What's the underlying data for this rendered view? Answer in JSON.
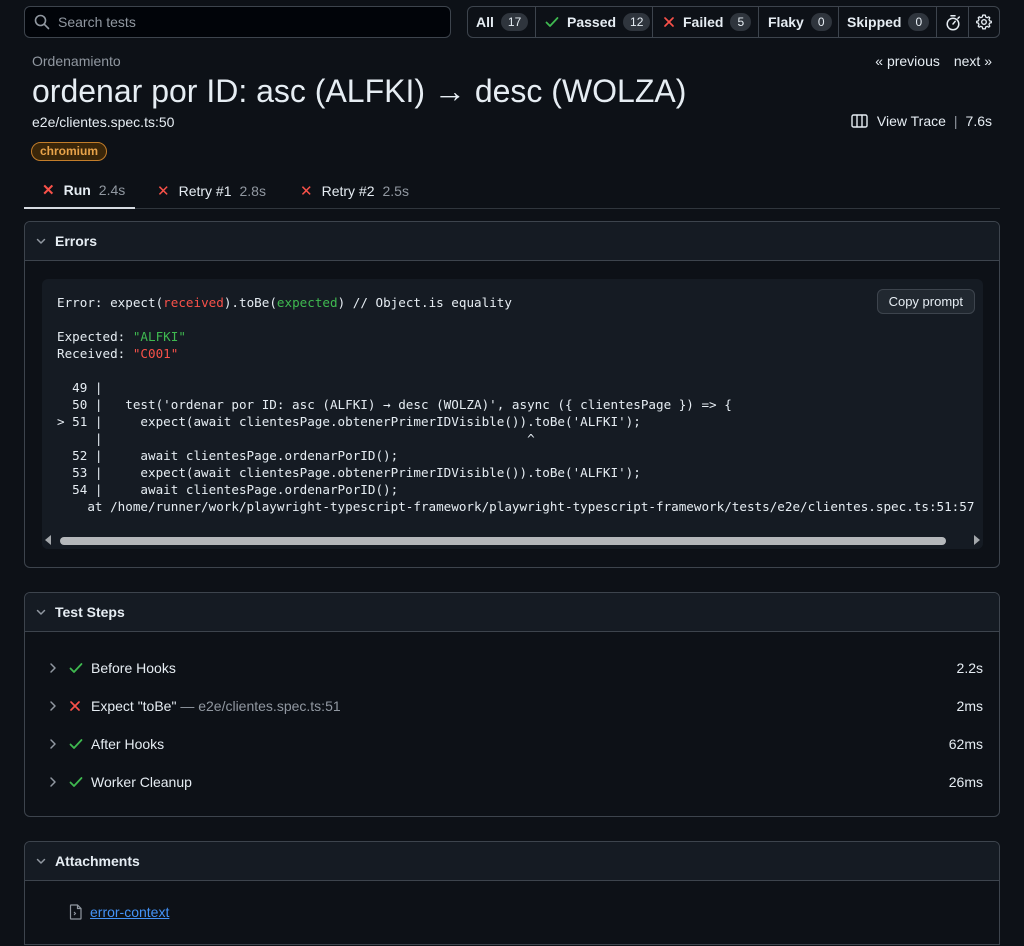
{
  "search": {
    "placeholder": "Search tests",
    "icon": "search-icon"
  },
  "filters": [
    {
      "label": "All",
      "count": "17"
    },
    {
      "label": "Passed",
      "count": "12",
      "icon": "check-icon"
    },
    {
      "label": "Failed",
      "count": "5",
      "icon": "x-icon"
    },
    {
      "label": "Flaky",
      "count": "0"
    },
    {
      "label": "Skipped",
      "count": "0"
    }
  ],
  "toolbar_icons": [
    "stopwatch-icon",
    "gear-icon"
  ],
  "header": {
    "project": "Ordenamiento",
    "previous": "« previous",
    "next": "next »",
    "title": "ordenar por ID: asc (ALFKI) → desc (WOLZA)",
    "location": "e2e/clientes.spec.ts:50",
    "view_trace": "View Trace",
    "separator": "|",
    "duration": "7.6s",
    "browser_badge": "chromium"
  },
  "tabs": [
    {
      "label": "Run",
      "duration": "2.4s",
      "active": true
    },
    {
      "label": "Retry #1",
      "duration": "2.8s"
    },
    {
      "label": "Retry #2",
      "duration": "2.5s"
    }
  ],
  "errors": {
    "heading": "Errors",
    "copy_prompt": "Copy prompt",
    "line1_pre": "Error: expect(",
    "line1_received": "received",
    "line1_mid": ").toBe(",
    "line1_expected": "expected",
    "line1_post": ") // Object.is equality",
    "expected_label": "Expected: ",
    "expected_value": "\"ALFKI\"",
    "received_label": "Received: ",
    "received_value": "\"C001\"",
    "code_lines": [
      "  49 |",
      "  50 |   test('ordenar por ID: asc (ALFKI) → desc (WOLZA)', async ({ clientesPage }) => {",
      "> 51 |     expect(await clientesPage.obtenerPrimerIDVisible()).toBe('ALFKI');",
      "     |                                                        ^",
      "  52 |     await clientesPage.ordenarPorID();",
      "  53 |     expect(await clientesPage.obtenerPrimerIDVisible()).toBe('ALFKI');",
      "  54 |     await clientesPage.ordenarPorID();",
      "    at /home/runner/work/playwright-typescript-framework/playwright-typescript-framework/tests/e2e/clientes.spec.ts:51:57"
    ]
  },
  "test_steps": {
    "heading": "Test Steps",
    "steps": [
      {
        "title": "Before Hooks",
        "location": "",
        "duration": "2.2s",
        "status": "passed"
      },
      {
        "title": "Expect \"toBe\"",
        "location": " — e2e/clientes.spec.ts:51",
        "duration": "2ms",
        "status": "failed"
      },
      {
        "title": "After Hooks",
        "location": "",
        "duration": "62ms",
        "status": "passed"
      },
      {
        "title": "Worker Cleanup",
        "location": "",
        "duration": "26ms",
        "status": "passed"
      }
    ]
  },
  "attachments": {
    "heading": "Attachments",
    "items": [
      {
        "name": "error-context",
        "icon": "file-icon"
      }
    ]
  },
  "colors": {
    "background": "#0d1117",
    "pass": "#3fb950",
    "fail": "#f85149",
    "badge": "#e8a34a",
    "link": "#4493f8"
  }
}
